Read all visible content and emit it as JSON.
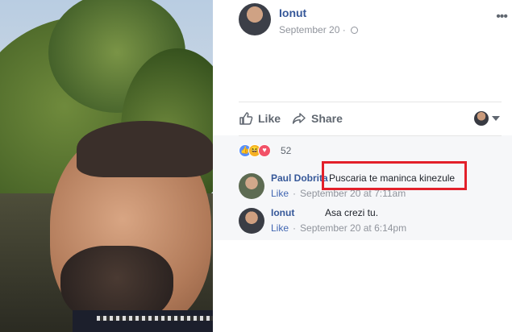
{
  "post": {
    "author": "Ionut",
    "timestamp": "September 20",
    "privacy_icon": "globe-icon",
    "more_icon": "more-dots-icon"
  },
  "actions": {
    "like_label": "Like",
    "share_label": "Share"
  },
  "reactions": {
    "types": [
      "like",
      "haha",
      "love"
    ],
    "count": "52"
  },
  "comments": [
    {
      "author": "Paul Dobrita",
      "text": "Puscaria te maninca kinezule",
      "like_label": "Like",
      "time": "September 20 at 7:11am"
    },
    {
      "author": "Ionut",
      "text": "Asa crezi tu.",
      "like_label": "Like",
      "time": "September 20 at 6:14pm"
    }
  ],
  "colors": {
    "link_blue": "#365899",
    "highlight_red": "#e2202a",
    "meta_gray": "#90949c"
  }
}
